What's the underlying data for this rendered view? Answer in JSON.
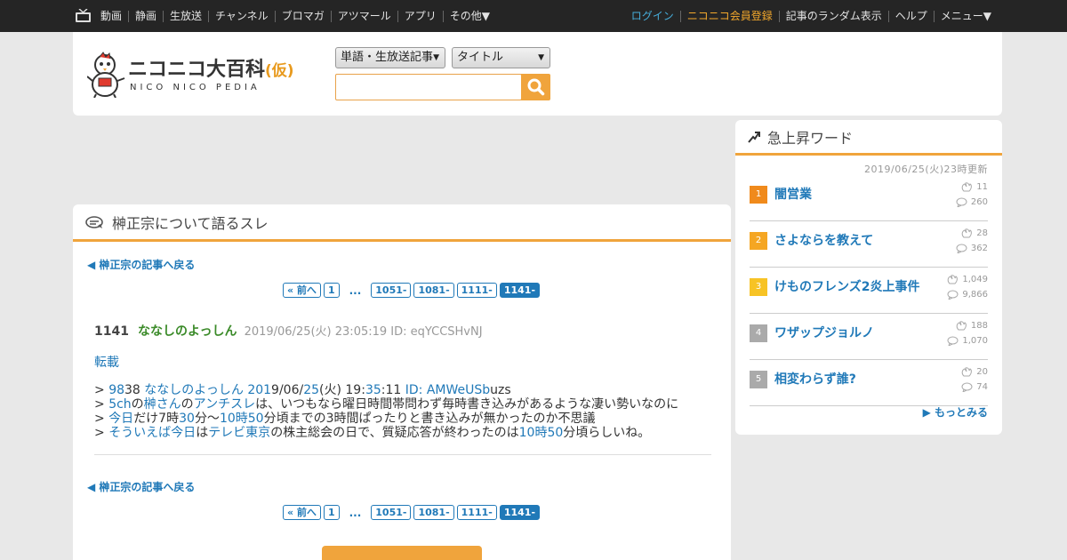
{
  "topbar": {
    "left_items": [
      "動画",
      "静画",
      "生放送",
      "チャンネル",
      "ブロマガ",
      "アツマール",
      "アプリ",
      "その他▼"
    ],
    "login": "ログイン",
    "register": "ニコニコ会員登録",
    "random": "記事のランダム表示",
    "help": "ヘルプ",
    "menu": "メニュー▼"
  },
  "logo": {
    "title": "ニコニコ大百科",
    "saku": "(仮)",
    "sub": "NICO NICO PEDIA"
  },
  "search": {
    "category": "単語・生放送記事",
    "mode": "タイトル",
    "value": ""
  },
  "main": {
    "title": "榊正宗について語るスレ",
    "back": "◀ 榊正宗の記事へ戻る",
    "pager": {
      "prev": "« 前へ",
      "first": "1",
      "dots": "...",
      "pages": [
        "1051-",
        "1081-",
        "1111-"
      ],
      "current": "1141-"
    },
    "post": {
      "number": "1141",
      "name": "ななしのよっしん",
      "meta": "2019/06/25(火) 23:05:19 ID: eqYCCSHvNJ",
      "tensai": "転載",
      "lines": [
        [
          [
            "> ",
            0
          ],
          [
            "98",
            1
          ],
          [
            "38 ",
            0
          ],
          [
            "ななしのよっしん ",
            1
          ],
          [
            "201",
            1
          ],
          [
            "9/06/",
            0
          ],
          [
            "25",
            1
          ],
          [
            "(火) 19:",
            0
          ],
          [
            "35",
            1
          ],
          [
            ":11 ",
            0
          ],
          [
            "ID: AMWeUSb",
            1
          ],
          [
            "uzs",
            0
          ]
        ],
        [
          [
            "> ",
            0
          ],
          [
            "5ch",
            1
          ],
          [
            "の",
            0
          ],
          [
            "榊さん",
            1
          ],
          [
            "の",
            0
          ],
          [
            "アンチスレ",
            1
          ],
          [
            "は、いつもなら曜日時間帯問わず毎時書き込みがあるような凄い勢いなのに",
            0
          ]
        ],
        [
          [
            "> ",
            0
          ],
          [
            "今日",
            1
          ],
          [
            "だけ7時",
            0
          ],
          [
            "30",
            1
          ],
          [
            "分～",
            0
          ],
          [
            "10時50",
            1
          ],
          [
            "分頃までの3時間ぱったりと書き込みが無かったのか不思議",
            0
          ]
        ],
        [
          [
            "> ",
            0
          ],
          [
            "そういえば",
            1
          ],
          [
            "今日",
            1
          ],
          [
            "は",
            0
          ],
          [
            "テレビ東京",
            1
          ],
          [
            "の株主総会の日で、質疑応答が終わったのは",
            0
          ],
          [
            "10時50",
            1
          ],
          [
            "分頃らしいね。",
            0
          ]
        ]
      ]
    }
  },
  "side": {
    "title": "急上昇ワード",
    "updated": "2019/06/25(火)23時更新",
    "ranks": [
      {
        "rank": "1",
        "word": "闇営業",
        "claps": "11",
        "comments": "260",
        "color": "#f08a1c"
      },
      {
        "rank": "2",
        "word": "さよならを教えて",
        "claps": "28",
        "comments": "362",
        "color": "#f5a623"
      },
      {
        "rank": "3",
        "word": "けものフレンズ2炎上事件",
        "claps": "1,049",
        "comments": "9,866",
        "color": "#f7c325"
      },
      {
        "rank": "4",
        "word": "ワザップジョルノ",
        "claps": "188",
        "comments": "1,070",
        "color": "#aaaaaa"
      },
      {
        "rank": "5",
        "word": "相変わらず誰?",
        "claps": "20",
        "comments": "74",
        "color": "#aaaaaa"
      }
    ],
    "more": "もっとみる"
  },
  "colors": {
    "accent": "#f0a43c",
    "link": "#2079b8",
    "name": "#3a8a28",
    "topbar": "#252525"
  }
}
